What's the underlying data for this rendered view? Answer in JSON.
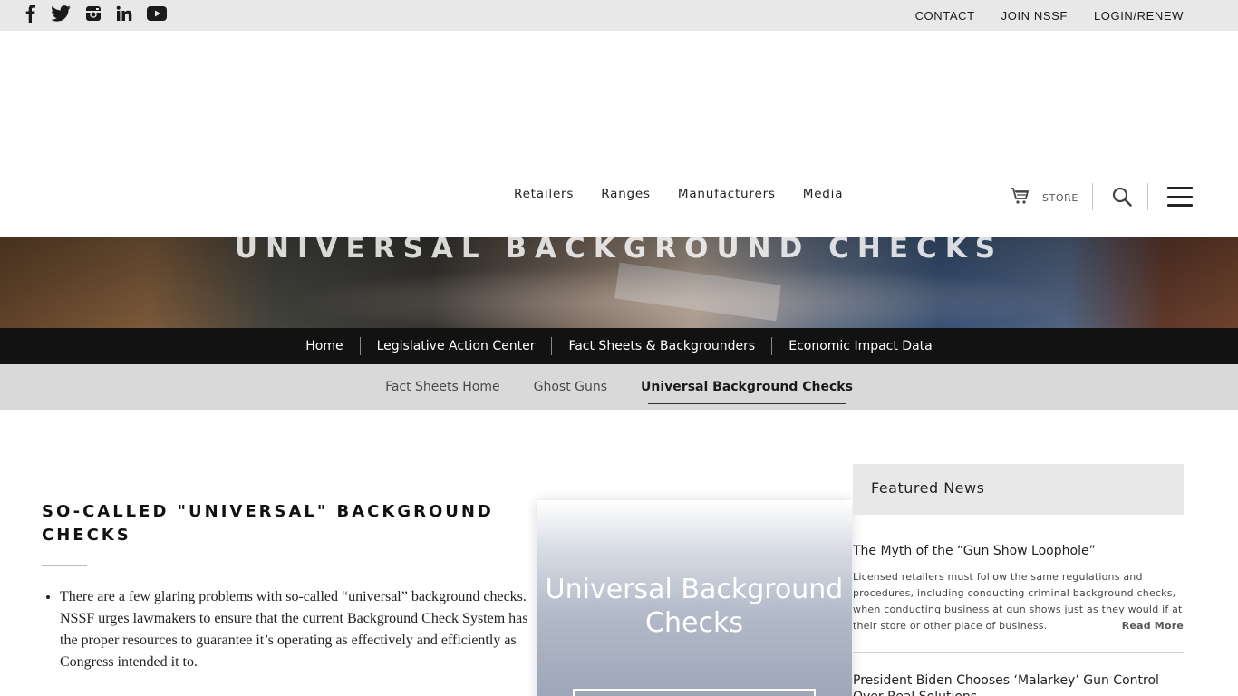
{
  "social": {
    "icons": [
      "facebook-icon",
      "twitter-icon",
      "instagram-icon",
      "linkedin-icon",
      "youtube-icon"
    ]
  },
  "topnav": {
    "contact": "CONTACT",
    "join": "JOIN NSSF",
    "login": "LOGIN/RENEW"
  },
  "mainnav": {
    "items": [
      "Retailers",
      "Ranges",
      "Manufacturers",
      "Media"
    ],
    "store_label": "STORE"
  },
  "hero": {
    "title": "UNIVERSAL BACKGROUND CHECKS"
  },
  "subnav": {
    "items": [
      "Home",
      "Legislative Action Center",
      "Fact Sheets & Backgrounders",
      "Economic Impact Data"
    ]
  },
  "tabs": {
    "items": [
      "Fact Sheets Home",
      "Ghost Guns",
      "Universal Background Checks"
    ],
    "active": "Universal Background Checks"
  },
  "article": {
    "heading": "SO-CALLED \"UNIVERSAL\" BACKGROUND CHECKS",
    "bullets": [
      "There are a few glaring problems with so-called “universal” background checks. NSSF urges lawmakers to ensure that the current Background Check System has the proper resources to guarantee it’s operating as effectively and efficiently as Congress intended it to."
    ]
  },
  "card": {
    "title": "Universal Background Checks"
  },
  "sidebar": {
    "heading": "Featured News",
    "news": [
      {
        "title": "The Myth of the “Gun Show Loophole”",
        "excerpt": "Licensed retailers must follow the same regulations and procedures, including conducting criminal background checks, when conducting business at gun shows just as they would if at their store or other place of business.",
        "more": "Read More"
      },
      {
        "title": "President Biden Chooses ‘Malarkey’ Gun Control Over Real Solutions"
      }
    ]
  },
  "colors": {
    "topbar_bg": "#e8e8e8",
    "subnav_bg": "#121212",
    "tabs_bg": "#d9d9d9",
    "sidebar_head_bg": "#e8e8e8"
  }
}
